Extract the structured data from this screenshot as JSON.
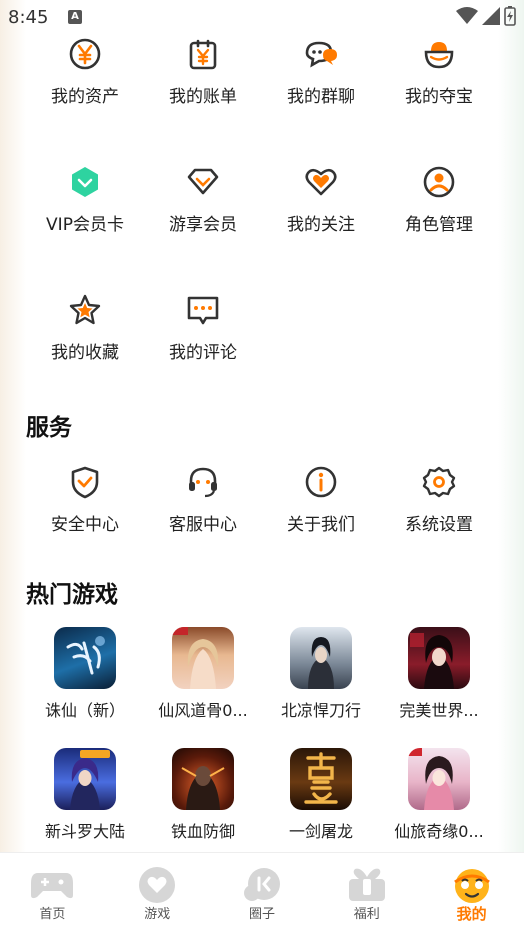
{
  "status_bar": {
    "time": "8:45",
    "a_badge": "A"
  },
  "assets": {
    "items": [
      {
        "label": "我的资产",
        "icon": "yuan-coin-icon"
      },
      {
        "label": "我的账单",
        "icon": "bill-icon"
      },
      {
        "label": "我的群聊",
        "icon": "group-chat-icon"
      },
      {
        "label": "我的夺宝",
        "icon": "treasure-icon"
      },
      {
        "label": "VIP会员卡",
        "icon": "vip-card-icon"
      },
      {
        "label": "游享会员",
        "icon": "diamond-icon"
      },
      {
        "label": "我的关注",
        "icon": "heart-icon"
      },
      {
        "label": "角色管理",
        "icon": "user-circle-icon"
      },
      {
        "label": "我的收藏",
        "icon": "star-icon"
      },
      {
        "label": "我的评论",
        "icon": "comment-icon"
      }
    ]
  },
  "services": {
    "title": "服务",
    "items": [
      {
        "label": "安全中心",
        "icon": "shield-icon"
      },
      {
        "label": "客服中心",
        "icon": "headset-icon"
      },
      {
        "label": "关于我们",
        "icon": "info-icon"
      },
      {
        "label": "系统设置",
        "icon": "settings-icon"
      }
    ]
  },
  "hot_games": {
    "title": "热门游戏",
    "items": [
      {
        "name": "诛仙（新）"
      },
      {
        "name": "仙风道骨0..."
      },
      {
        "name": "北凉悍刀行"
      },
      {
        "name": "完美世界..."
      },
      {
        "name": "新斗罗大陆"
      },
      {
        "name": "铁血防御"
      },
      {
        "name": "一剑屠龙"
      },
      {
        "name": "仙旅奇缘0..."
      }
    ]
  },
  "tabbar": {
    "tabs": [
      {
        "label": "首页",
        "icon": "gamepad-icon"
      },
      {
        "label": "游戏",
        "icon": "game-heart-icon"
      },
      {
        "label": "圈子",
        "icon": "circle-icon"
      },
      {
        "label": "福利",
        "icon": "gift-icon"
      },
      {
        "label": "我的",
        "icon": "profile-face-icon"
      }
    ],
    "active": "我的"
  },
  "colors": {
    "accent": "#ff7a00",
    "text": "#222222",
    "vip": "#2ed3a0"
  }
}
